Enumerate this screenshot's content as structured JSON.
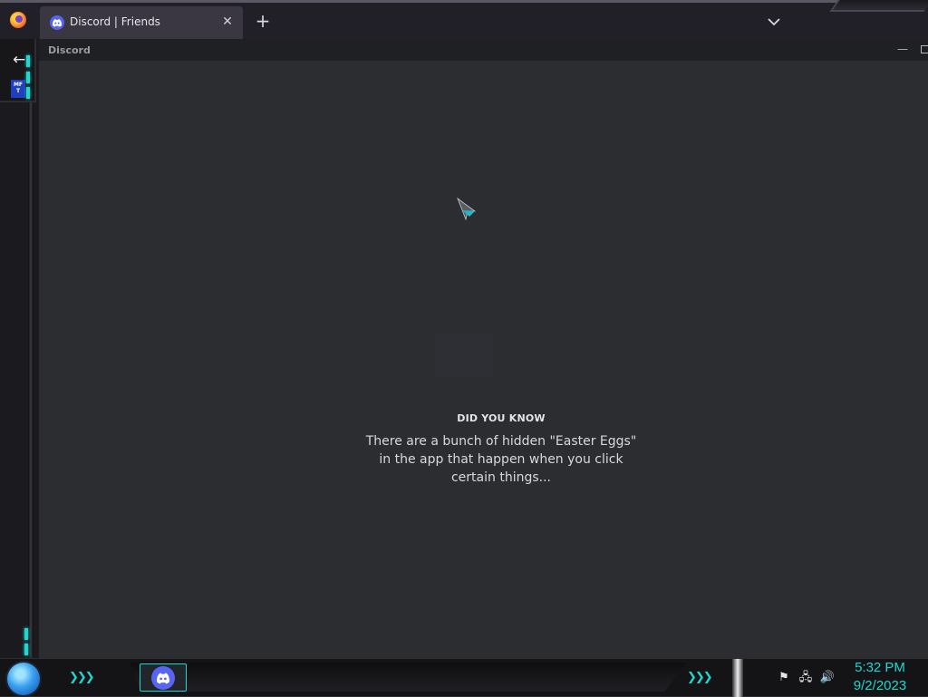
{
  "browser": {
    "tab_title": "Discord | Friends",
    "tab_close_glyph": "✕",
    "new_tab_glyph": "+",
    "tabs_list_icon": "chevron-down-icon"
  },
  "sidebar": {
    "back_glyph": "←",
    "extension_badge": "MF T"
  },
  "app": {
    "name": "Discord",
    "minimize_glyph": "—",
    "loading": {
      "heading": "DID YOU KNOW",
      "tip": "There are a bunch of hidden \"Easter Eggs\" in the app that happen when you click certain things..."
    }
  },
  "taskbar": {
    "chevrons": "❯❯❯",
    "chevrons_right": "❯❯❯",
    "tray_flag": "⚑",
    "tray_network": "🖧",
    "tray_volume": "🔊",
    "time": "5:32 PM",
    "date": "9/2/2023"
  },
  "colors": {
    "accent_cyan": "#1fd6d0",
    "discord_blurple": "#5865f2",
    "app_bg": "#2b2d31"
  }
}
